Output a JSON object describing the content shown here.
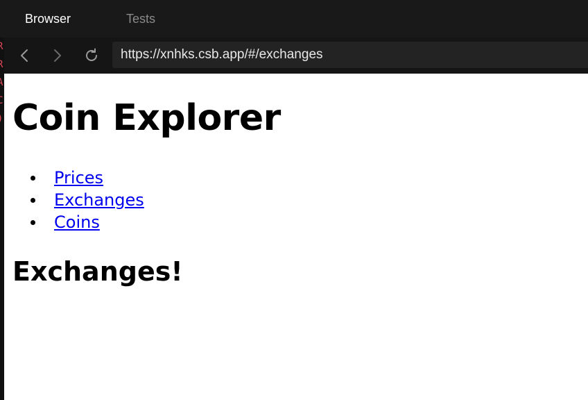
{
  "tabs": [
    {
      "label": "Browser",
      "active": true
    },
    {
      "label": "Tests",
      "active": false
    }
  ],
  "left_strip_glyphs": [
    "R",
    "R",
    "A",
    "C",
    ")"
  ],
  "address_bar": {
    "url": "https://xnhks.csb.app/#/exchanges"
  },
  "nav_icons": [
    "back-arrow-icon",
    "forward-arrow-icon",
    "reload-icon"
  ],
  "page": {
    "title": "Coin Explorer",
    "nav_links": [
      {
        "label": "Prices"
      },
      {
        "label": "Exchanges"
      },
      {
        "label": "Coins"
      }
    ],
    "heading": "Exchanges!"
  },
  "colors": {
    "link": "#0000ee",
    "chrome_bg": "#191919",
    "url_bg": "#232323",
    "strip_text": "#e24a5a"
  }
}
